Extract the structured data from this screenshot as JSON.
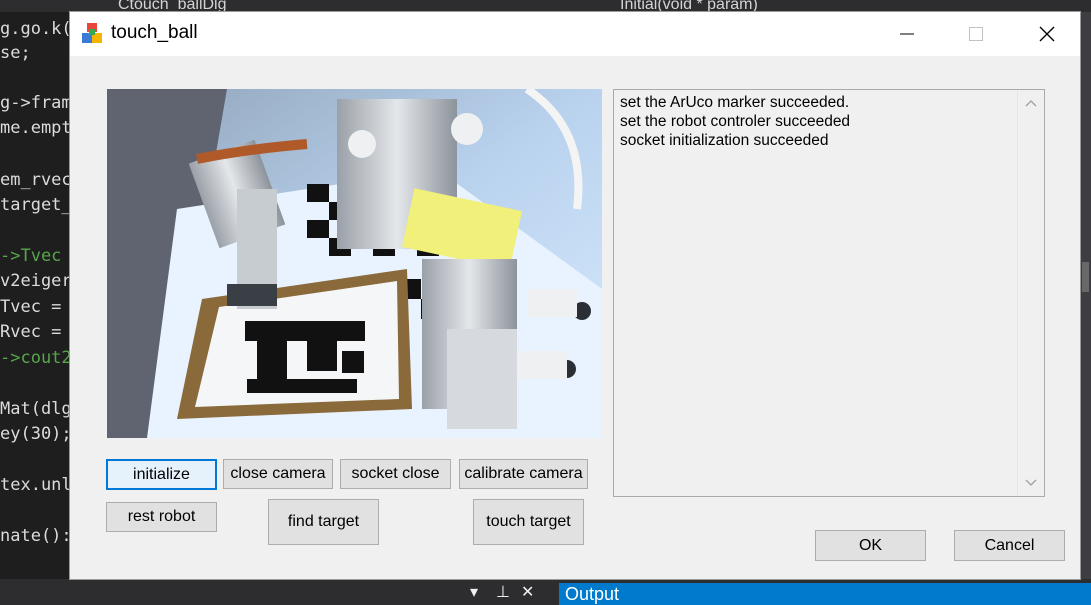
{
  "ide": {
    "tabs": [
      "Ctouch_ballDlg",
      "Initial(void * param)"
    ],
    "code_lines": [
      {
        "text": "g.go.k(",
        "green": false
      },
      {
        "text": "se;",
        "green": false
      },
      {
        "text": "g->fram",
        "green": false
      },
      {
        "text": "me.empt",
        "green": false
      },
      {
        "text": "em_rvec",
        "green": false
      },
      {
        "text": "target_",
        "green": false
      },
      {
        "text": "->Tvec",
        "green": true
      },
      {
        "text": "v2eiger",
        "green": false
      },
      {
        "text": "Tvec =",
        "green": false
      },
      {
        "text": "Rvec =",
        "green": false
      },
      {
        "text": "->cout2",
        "green": true
      },
      {
        "text": "Mat(dlg",
        "green": false
      },
      {
        "text": "ey(30);",
        "green": false
      },
      {
        "text": "tex.unl",
        "green": false
      },
      {
        "text": "nate():",
        "green": false
      }
    ],
    "bottom_controls": [
      "▾",
      "⊥",
      "✕"
    ],
    "output_label": "Output"
  },
  "dialog": {
    "title": "touch_ball",
    "minimize_icon": "minimize-icon",
    "maximize_icon": "maximize-icon",
    "close_icon": "close-icon",
    "log_lines": [
      "set the ArUco marker succeeded.",
      "set the robot controler succeeded",
      "socket initialization succeeded"
    ],
    "buttons": {
      "initialize": "initialize",
      "close_camera": "close camera",
      "socket_close": "socket close",
      "calibrate_camera": "calibrate camera",
      "rest_robot": "rest robot",
      "find_target": "find target",
      "touch_target": "touch target",
      "ok": "OK",
      "cancel": "Cancel"
    }
  },
  "colors": {
    "accent": "#0078d7",
    "output_bar": "#007acc"
  }
}
